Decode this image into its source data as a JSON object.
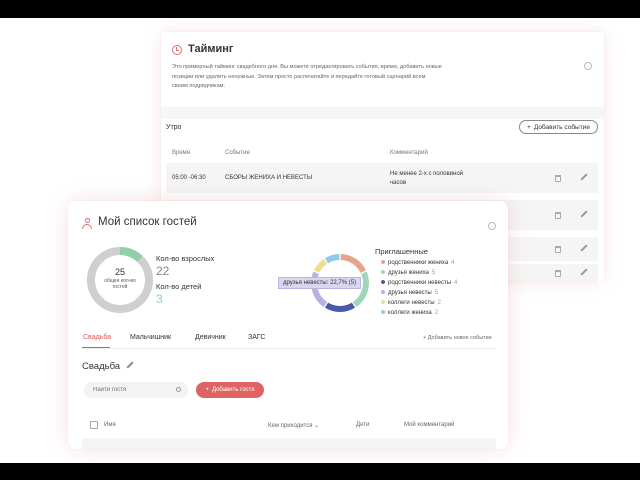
{
  "timing": {
    "title": "Тайминг",
    "description": "Это примерный тайминг свадебного дня. Вы можете отредактировать события, время, добавить новые позиции или удалить ненужные. Затем просто распечатайте и передайте готовый сценарий всем своим подрядчикам.",
    "section": "Утро",
    "add_event_label": "Добавить событие",
    "columns": [
      "Время",
      "Событие",
      "Комментарий"
    ],
    "rows": [
      {
        "time": "05:00 -06:30",
        "event": "СБОРЫ ЖЕНИХА И НЕВЕСТЫ",
        "comment": "Не менее 2-х с половиной часов"
      }
    ]
  },
  "guests": {
    "title": "Мой список гостей",
    "total_value": "25",
    "total_label": "общее кол-во гостей",
    "adults_label": "Кол-во взрослых",
    "adults_value": "22",
    "children_label": "Кол-во детей",
    "children_value": "3",
    "adults_fraction": 0.88,
    "invited_title": "Приглашенные",
    "tooltip": "друзья невесты: 22,7% (5)",
    "legend": [
      {
        "label": "родственники жениха",
        "count": "4",
        "color": "#e8a48a"
      },
      {
        "label": "друзья жениха",
        "count": "5",
        "color": "#9fd6b9"
      },
      {
        "label": "родственники невесты",
        "count": "4",
        "color": "#4a5aa8"
      },
      {
        "label": "друзья невесты",
        "count": "5",
        "color": "#b6b2e2"
      },
      {
        "label": "коллеги невесты",
        "count": "2",
        "color": "#f0de90"
      },
      {
        "label": "коллеги жениха",
        "count": "2",
        "color": "#8ecbe6"
      }
    ],
    "tabs": [
      "Свадьба",
      "Мальчишник",
      "Девичник",
      "ЗАГС"
    ],
    "add_new_event": "Добавить новое событие",
    "section_title": "Свадьба",
    "search_placeholder": "Найти гостя",
    "add_guest_label": "Добавить гостя",
    "table_headers": [
      "Имя",
      "Кем приходится",
      "Дети",
      "Мой комментарий"
    ]
  },
  "colors": {
    "accent": "#e06363",
    "ring_adults": "#cfcfcf",
    "ring_children": "#8fd0a8"
  }
}
